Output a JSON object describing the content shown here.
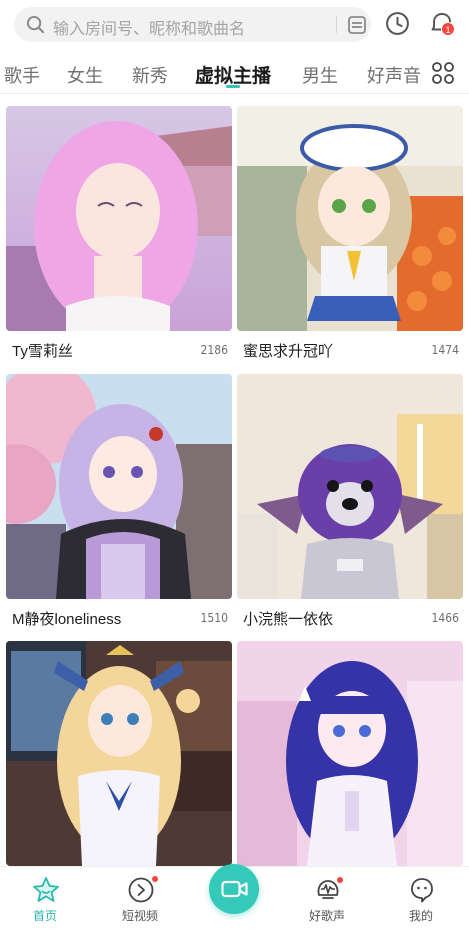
{
  "search": {
    "placeholder": "输入房间号、昵称和歌曲名"
  },
  "header": {
    "message_badge": "1"
  },
  "tabs": [
    {
      "label": "歌手"
    },
    {
      "label": "女生"
    },
    {
      "label": "新秀"
    },
    {
      "label": "虚拟主播",
      "active": true
    },
    {
      "label": "男生"
    },
    {
      "label": "好声音"
    }
  ],
  "rooms": [
    {
      "name": "Ty雪莉丝",
      "count": "2186"
    },
    {
      "name": "蜜思求升冠吖",
      "count": "1474"
    },
    {
      "name": "M静夜loneliness",
      "count": "1510"
    },
    {
      "name": "小浣熊一依依",
      "count": "1466"
    },
    {
      "name": "",
      "count": ""
    },
    {
      "name": "",
      "count": ""
    }
  ],
  "bottom_nav": [
    {
      "label": "首页",
      "icon": "home-star-icon",
      "active": true
    },
    {
      "label": "短视频",
      "icon": "short-video-icon"
    },
    {
      "label": "",
      "icon": "camera-icon"
    },
    {
      "label": "好歌声",
      "icon": "good-voice-icon"
    },
    {
      "label": "我的",
      "icon": "profile-icon"
    }
  ],
  "colors": {
    "accent": "#34c9b8",
    "badge": "#f5463c"
  }
}
